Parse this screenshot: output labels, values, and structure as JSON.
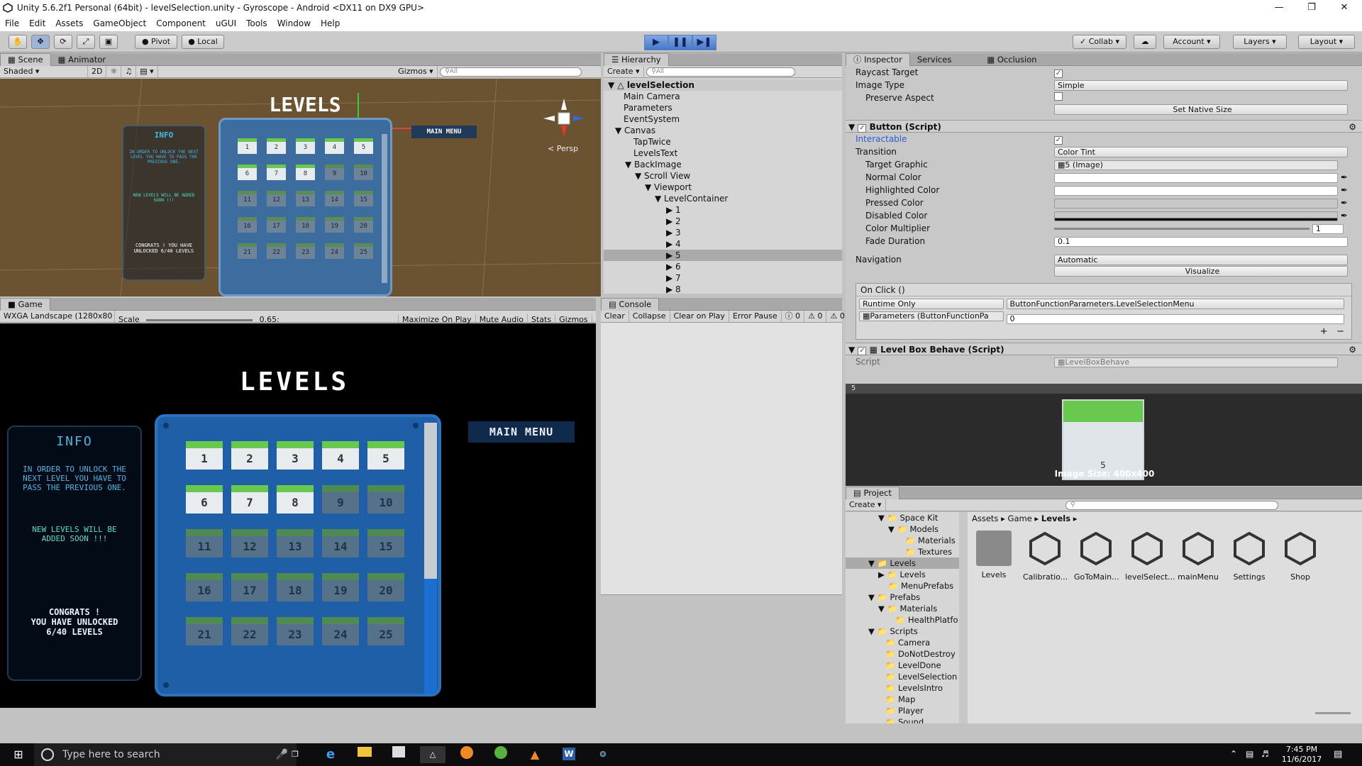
{
  "window": {
    "title": "Unity 5.6.2f1 Personal (64bit) - levelSelection.unity - Gyroscope - Android <DX11 on DX9 GPU>"
  },
  "menu": [
    "File",
    "Edit",
    "Assets",
    "GameObject",
    "Component",
    "uGUI",
    "Tools",
    "Window",
    "Help"
  ],
  "toolbar": {
    "pivot": "Pivot",
    "local": "Local",
    "collab": "Collab",
    "account": "Account",
    "layers": "Layers",
    "layout": "Layout"
  },
  "scene": {
    "tabs": [
      "Scene",
      "Animator"
    ],
    "shading": "Shaded",
    "mode2d": "2D",
    "gizmos": "Gizmos",
    "search_placeholder": "All",
    "persp": "< Persp",
    "title": "LEVELS",
    "info": "INFO",
    "info_text": "IN ORDER TO UNLOCK THE NEXT LEVEL YOU HAVE TO PASS THE PREVIOUS ONE.",
    "new_levels": "NEW LEVELS WILL BE ADDED SOON !!!",
    "congrats": "CONGRATS ! YOU HAVE UNLOCKED 6/40 LEVELS",
    "main_menu": "MAIN MENU"
  },
  "game": {
    "tab": "Game",
    "resolution": "WXGA Landscape (1280x80",
    "scale_label": "Scale",
    "scale_value": "0.65:",
    "options": [
      "Maximize On Play",
      "Mute Audio",
      "Stats",
      "Gizmos"
    ],
    "title": "LEVELS",
    "info": "INFO",
    "info_text": "IN ORDER TO UNLOCK THE NEXT LEVEL YOU HAVE TO PASS THE PREVIOUS ONE.",
    "new_levels": "NEW LEVELS WILL BE ADDED SOON !!!",
    "congrats_1": "CONGRATS !",
    "congrats_2": "YOU HAVE UNLOCKED",
    "congrats_3": "6/40 LEVELS",
    "main_menu": "MAIN MENU",
    "levels": [
      {
        "n": "1",
        "unlocked": true
      },
      {
        "n": "2",
        "unlocked": true
      },
      {
        "n": "3",
        "unlocked": true
      },
      {
        "n": "4",
        "unlocked": true
      },
      {
        "n": "5",
        "unlocked": true
      },
      {
        "n": "6",
        "unlocked": true
      },
      {
        "n": "7",
        "unlocked": true
      },
      {
        "n": "8",
        "unlocked": true
      },
      {
        "n": "9",
        "unlocked": false
      },
      {
        "n": "10",
        "unlocked": false
      },
      {
        "n": "11",
        "unlocked": false
      },
      {
        "n": "12",
        "unlocked": false
      },
      {
        "n": "13",
        "unlocked": false
      },
      {
        "n": "14",
        "unlocked": false
      },
      {
        "n": "15",
        "unlocked": false
      },
      {
        "n": "16",
        "unlocked": false
      },
      {
        "n": "17",
        "unlocked": false
      },
      {
        "n": "18",
        "unlocked": false
      },
      {
        "n": "19",
        "unlocked": false
      },
      {
        "n": "20",
        "unlocked": false
      },
      {
        "n": "21",
        "unlocked": false
      },
      {
        "n": "22",
        "unlocked": false
      },
      {
        "n": "23",
        "unlocked": false
      },
      {
        "n": "24",
        "unlocked": false
      },
      {
        "n": "25",
        "unlocked": false
      }
    ]
  },
  "hierarchy": {
    "tab": "Hierarchy",
    "create": "Create",
    "search_placeholder": "All",
    "scene_name": "levelSelection",
    "items": [
      "Main Camera",
      "Parameters",
      "EventSystem",
      "Canvas",
      "TapTwice",
      "LevelsText",
      "BackImage",
      "Scroll View",
      "Viewport",
      "LevelContainer",
      "1",
      "2",
      "3",
      "4",
      "5",
      "6",
      "7",
      "8"
    ]
  },
  "console": {
    "tab": "Console",
    "buttons": [
      "Clear",
      "Collapse",
      "Clear on Play",
      "Error Pause"
    ],
    "counts": [
      "0",
      "0",
      "0"
    ]
  },
  "inspector": {
    "tabs": [
      "Inspector",
      "Services",
      "Occlusion"
    ],
    "raycast_target": "Raycast Target",
    "image_type": "Image Type",
    "image_type_value": "Simple",
    "preserve_aspect": "Preserve Aspect",
    "set_native_size": "Set Native Size",
    "button_script": "Button (Script)",
    "interactable": "Interactable",
    "transition": "Transition",
    "transition_value": "Color Tint",
    "target_graphic": "Target Graphic",
    "target_graphic_value": "5 (Image)",
    "normal_color": "Normal Color",
    "highlighted_color": "Highlighted Color",
    "pressed_color": "Pressed Color",
    "disabled_color": "Disabled Color",
    "color_multiplier": "Color Multiplier",
    "color_multiplier_value": "1",
    "fade_duration": "Fade Duration",
    "fade_duration_value": "0.1",
    "navigation": "Navigation",
    "navigation_value": "Automatic",
    "visualize": "Visualize",
    "on_click": "On Click ()",
    "runtime_only": "Runtime Only",
    "function": "ButtonFunctionParameters.LevelSelectionMenu",
    "parameters": "Parameters (ButtonFunctionPa",
    "param_value": "0",
    "level_box_script": "Level Box Behave (Script)",
    "script_label": "Script",
    "script_value": "LevelBoxBehave",
    "preview_title": "5",
    "preview_caption": "Image Size: 400x400",
    "preview_num": "5"
  },
  "project": {
    "tab": "Project",
    "create": "Create",
    "tree": [
      "Space Kit",
      "Models",
      "Materials",
      "Textures",
      "Levels",
      "Levels",
      "MenuPrefabs",
      "Prefabs",
      "Materials",
      "HealthPlatfo",
      "Scripts",
      "Camera",
      "DoNotDestroy",
      "LevelDone",
      "LevelSelection",
      "LevelsIntro",
      "Map",
      "Player",
      "Sound"
    ],
    "breadcrumb": [
      "Assets",
      "Game",
      "Levels"
    ],
    "assets": [
      "Levels",
      "Calibratio...",
      "GoToMain...",
      "levelSelect...",
      "mainMenu",
      "Settings",
      "Shop"
    ]
  },
  "taskbar": {
    "search_placeholder": "Type here to search",
    "time": "7:45 PM",
    "date": "11/6/2017"
  },
  "colors": {
    "accent": "#4679c8",
    "neon": "#47b6e6",
    "tile_green": "#69c94f",
    "board": "#1f5fa8"
  }
}
